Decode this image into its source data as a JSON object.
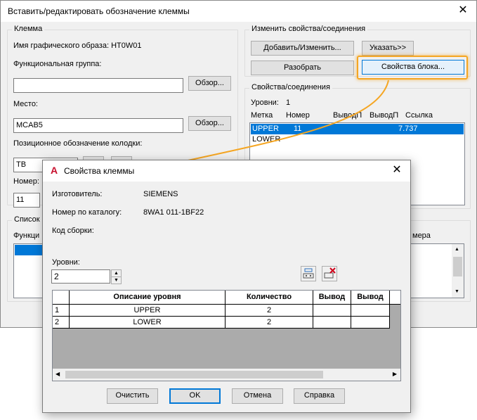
{
  "main_window": {
    "title": "Вставить/редактировать обозначение клеммы",
    "close_glyph": "✕",
    "terminal_group": {
      "title": "Клемма",
      "block_name_label": "Имя графического образа: HT0W01",
      "func_group_label": "Функциональная группа:",
      "func_group_value": "",
      "browse_label": "Обзор...",
      "location_label": "Место:",
      "location_value": "MCAB5",
      "strip_label": "Позиционное обозначение колодки:",
      "strip_value": "TB",
      "number_label": "Номер:",
      "number_value": "11"
    },
    "list_group": {
      "title_partial": "Список п",
      "col_partial": "Функци",
      "col_partial_right": "мера"
    },
    "change_group": {
      "title": "Изменить свойства/соединения",
      "add_modify_label": "Добавить/Изменить...",
      "pick_label": "Указать>>",
      "break_apart_label": "Разобрать",
      "block_props_label": "Свойства блока..."
    },
    "props_group": {
      "title": "Свойства/соединения",
      "levels_label": "Уровни:",
      "levels_value": "1",
      "columns": [
        "Метка",
        "Номер",
        "ВыводП",
        "ВыводП",
        "Ссылка"
      ],
      "rows": [
        {
          "label": "UPPER",
          "number": "11",
          "ref": "7.737",
          "selected": true
        },
        {
          "label": "LOWER",
          "number": "",
          "ref": "",
          "selected": false
        }
      ]
    }
  },
  "dialog": {
    "icon_letter": "A",
    "title": "Свойства клеммы",
    "close_glyph": "✕",
    "manufacturer_label": "Изготовитель:",
    "manufacturer_value": "SIEMENS",
    "catalog_label": "Номер по каталогу:",
    "catalog_value": "8WA1 011-1BF22",
    "assembly_label": "Код сборки:",
    "levels_label": "Уровни:",
    "levels_value": "2",
    "table": {
      "columns": [
        "Описание уровня",
        "Количество",
        "Вывод",
        "Вывод"
      ],
      "rows": [
        {
          "index": "1",
          "description": "UPPER",
          "quantity": "2"
        },
        {
          "index": "2",
          "description": "LOWER",
          "quantity": "2"
        }
      ]
    },
    "buttons": {
      "clear": "Очистить",
      "ok": "OK",
      "cancel": "Отмена",
      "help": "Справка"
    }
  },
  "colors": {
    "highlight": "#f5a623",
    "selection": "#0078d7",
    "autocad_red": "#c8102e"
  }
}
